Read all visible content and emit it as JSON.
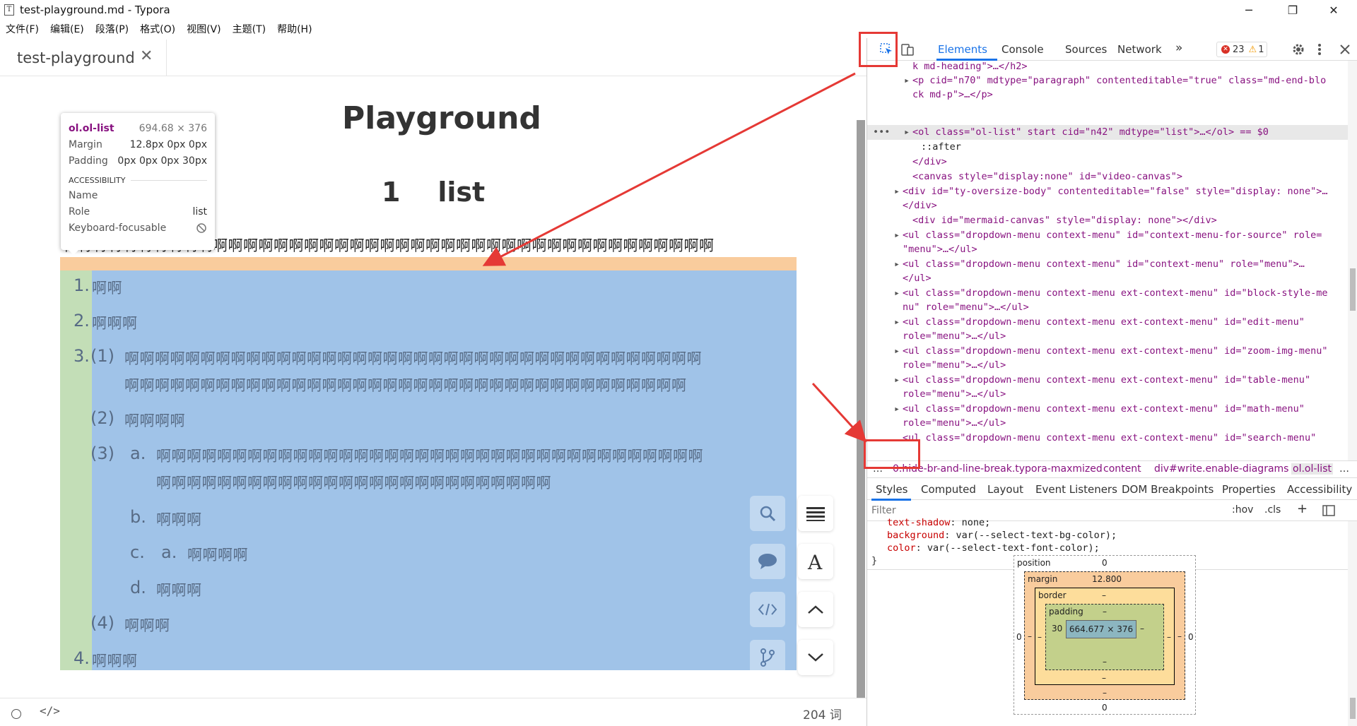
{
  "window": {
    "title": "test-playground.md - Typora",
    "minimize_glyph": "─",
    "maximize_glyph": "❐",
    "close_glyph": "✕"
  },
  "menubar": [
    "文件(F)",
    "编辑(E)",
    "段落(P)",
    "格式(O)",
    "视图(V)",
    "主题(T)",
    "帮助(H)"
  ],
  "tabs": [
    {
      "label": "test-playground",
      "close_glyph": "✕"
    }
  ],
  "document": {
    "h1": "Playground",
    "h2": "1    list",
    "paragraph": "啊啊啊啊啊啊啊啊啊啊啊啊啊啊啊啊啊啊啊啊啊啊啊啊啊啊啊啊啊啊啊啊啊啊啊啊啊啊啊啊啊啊啊",
    "list": [
      {
        "marker": "1.",
        "text": "啊啊"
      },
      {
        "marker": "2.",
        "text": "啊啊啊"
      },
      {
        "marker": "3.",
        "sub_marker": "(1)",
        "line1": "啊啊啊啊啊啊啊啊啊啊啊啊啊啊啊啊啊啊啊啊啊啊啊啊啊啊啊啊啊啊啊啊啊啊啊啊啊啊",
        "line2": "啊啊啊啊啊啊啊啊啊啊啊啊啊啊啊啊啊啊啊啊啊啊啊啊啊啊啊啊啊啊啊啊啊啊啊啊啊"
      },
      {
        "marker": "(2)",
        "text": "啊啊啊啊"
      },
      {
        "marker": "(3)",
        "sub_marker": "a.",
        "line1": "啊啊啊啊啊啊啊啊啊啊啊啊啊啊啊啊啊啊啊啊啊啊啊啊啊啊啊啊啊啊啊啊啊啊啊啊",
        "line2": "啊啊啊啊啊啊啊啊啊啊啊啊啊啊啊啊啊啊啊啊啊啊啊啊啊啊"
      },
      {
        "marker": "b.",
        "text": "啊啊啊"
      },
      {
        "marker": "c.",
        "sub_marker": "a.",
        "text": "啊啊啊啊"
      },
      {
        "marker": "d.",
        "text": "啊啊啊"
      },
      {
        "marker": "(4)",
        "text": "啊啊啊"
      },
      {
        "marker": "4.",
        "text": "啊啊啊"
      }
    ]
  },
  "inspect_tooltip": {
    "selector": "ol.ol-list",
    "size": "694.68 × 376",
    "margin_label": "Margin",
    "margin_value": "12.8px 0px 0px",
    "padding_label": "Padding",
    "padding_value": "0px 0px 0px 30px",
    "section": "ACCESSIBILITY",
    "name_label": "Name",
    "name_value": "",
    "role_label": "Role",
    "role_value": "list",
    "focus_label": "Keyboard-focusable"
  },
  "statusbar": {
    "code_glyph": "</>",
    "word_count": "204 词"
  },
  "devtools": {
    "tabs": [
      "Elements",
      "Console",
      "Sources",
      "Network",
      "»"
    ],
    "errors": "23",
    "warnings": "1",
    "tree": [
      "k md-heading\">…</h2>",
      "<p cid=\"n70\" mdtype=\"paragraph\" contenteditable=\"true\" class=\"md-end-blo",
      "ck md-p\">…</p>",
      "<ol class=\"ol-list\" start cid=\"n42\" mdtype=\"list\">…</ol> == $0",
      "::after",
      "</div>",
      "<canvas style=\"display:none\" id=\"video-canvas\">",
      "<div id=\"ty-oversize-body\" contenteditable=\"false\" style=\"display: none\">…",
      "</div>",
      "<div id=\"mermaid-canvas\" style=\"display: none\"></div>",
      "<ul class=\"dropdown-menu context-menu\" id=\"context-menu-for-source\" role=",
      "\"menu\">…</ul>",
      "<ul class=\"dropdown-menu context-menu\" id=\"context-menu\" role=\"menu\">…",
      "</ul>",
      "<ul class=\"dropdown-menu context-menu ext-context-menu\" id=\"block-style-me",
      "nu\" role=\"menu\">…</ul>",
      "<ul class=\"dropdown-menu context-menu ext-context-menu\" id=\"edit-menu\"",
      "role=\"menu\">…</ul>",
      "<ul class=\"dropdown-menu context-menu ext-context-menu\" id=\"zoom-img-menu\"",
      "role=\"menu\">…</ul>",
      "<ul class=\"dropdown-menu context-menu ext-context-menu\" id=\"table-menu\"",
      "role=\"menu\">…</ul>",
      "<ul class=\"dropdown-menu context-menu ext-context-menu\" id=\"math-menu\"",
      "role=\"menu\">…</ul>",
      "<ul class=\"dropdown-menu context-menu ext-context-menu\" id=\"search-menu\""
    ],
    "breadcrumbs": [
      "…",
      "0.hide-br-and-line-break.typora-maxmized",
      "content",
      "div#write.enable-diagrams",
      "ol.ol-list",
      "…"
    ],
    "subtabs": [
      "Styles",
      "Computed",
      "Layout",
      "Event Listeners",
      "DOM Breakpoints",
      "Properties",
      "Accessibility"
    ],
    "filter_placeholder": "Filter",
    "filter_hov": ":hov",
    "filter_cls": ".cls",
    "css_lines": [
      {
        "prop": "text-shadow",
        "value": "none;"
      },
      {
        "prop": "background",
        "value": "var(--select-text-bg-color);"
      },
      {
        "prop": "color",
        "value": "var(--select-text-font-color);"
      }
    ],
    "css_close": "}",
    "boxmodel": {
      "position_label": "position",
      "position_top": "0",
      "position_left": "0",
      "position_right": "0",
      "position_bottom": "0",
      "margin_label": "margin",
      "margin_top": "12.800",
      "margin_left": "–",
      "margin_right": "–",
      "margin_bottom": "–",
      "border_label": "border",
      "border_top": "–",
      "border_left": "–",
      "border_right": "–",
      "border_bottom": "–",
      "padding_label": "padding",
      "padding_top": "–",
      "padding_left": "30",
      "padding_right": "–",
      "padding_bottom": "–",
      "content": "664.677 × 376"
    }
  },
  "colors": {
    "accent": "#1a73e8",
    "annotation": "#e53935",
    "margin_hl": "#f9cc9d",
    "padding_hl": "#c3deb7",
    "content_hl": "#a0c3e8"
  }
}
